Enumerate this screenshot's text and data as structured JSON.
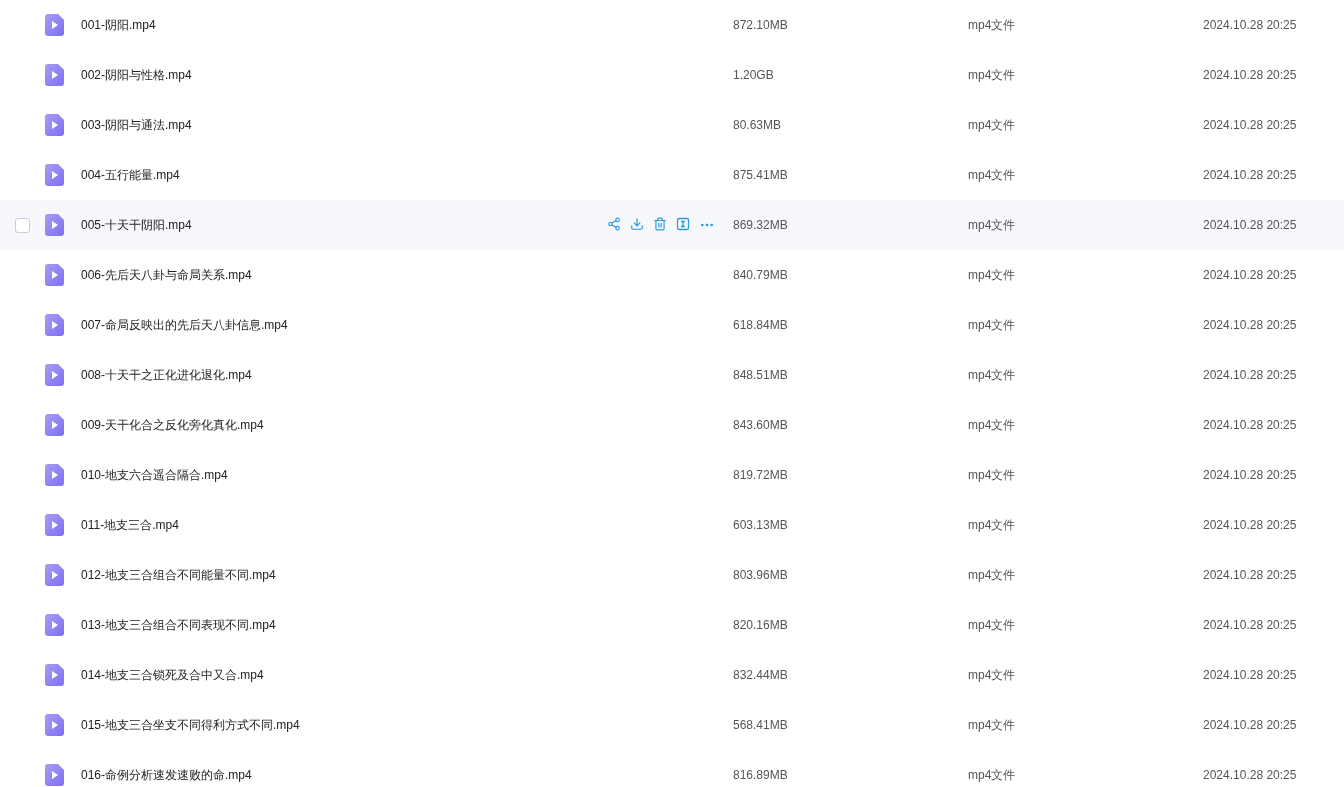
{
  "files": [
    {
      "name": "001-阴阳.mp4",
      "size": "872.10MB",
      "type": "mp4文件",
      "date": "2024.10.28 20:25",
      "hovered": false
    },
    {
      "name": "002-阴阳与性格.mp4",
      "size": "1.20GB",
      "type": "mp4文件",
      "date": "2024.10.28 20:25",
      "hovered": false
    },
    {
      "name": "003-阴阳与通法.mp4",
      "size": "80.63MB",
      "type": "mp4文件",
      "date": "2024.10.28 20:25",
      "hovered": false
    },
    {
      "name": "004-五行能量.mp4",
      "size": "875.41MB",
      "type": "mp4文件",
      "date": "2024.10.28 20:25",
      "hovered": false
    },
    {
      "name": "005-十天干阴阳.mp4",
      "size": "869.32MB",
      "type": "mp4文件",
      "date": "2024.10.28 20:25",
      "hovered": true
    },
    {
      "name": "006-先后天八卦与命局关系.mp4",
      "size": "840.79MB",
      "type": "mp4文件",
      "date": "2024.10.28 20:25",
      "hovered": false
    },
    {
      "name": "007-命局反映出的先后天八卦信息.mp4",
      "size": "618.84MB",
      "type": "mp4文件",
      "date": "2024.10.28 20:25",
      "hovered": false
    },
    {
      "name": "008-十天干之正化进化退化.mp4",
      "size": "848.51MB",
      "type": "mp4文件",
      "date": "2024.10.28 20:25",
      "hovered": false
    },
    {
      "name": "009-天干化合之反化旁化真化.mp4",
      "size": "843.60MB",
      "type": "mp4文件",
      "date": "2024.10.28 20:25",
      "hovered": false
    },
    {
      "name": "010-地支六合遥合隔合.mp4",
      "size": "819.72MB",
      "type": "mp4文件",
      "date": "2024.10.28 20:25",
      "hovered": false
    },
    {
      "name": "011-地支三合.mp4",
      "size": "603.13MB",
      "type": "mp4文件",
      "date": "2024.10.28 20:25",
      "hovered": false
    },
    {
      "name": "012-地支三合组合不同能量不同.mp4",
      "size": "803.96MB",
      "type": "mp4文件",
      "date": "2024.10.28 20:25",
      "hovered": false
    },
    {
      "name": "013-地支三合组合不同表现不同.mp4",
      "size": "820.16MB",
      "type": "mp4文件",
      "date": "2024.10.28 20:25",
      "hovered": false
    },
    {
      "name": "014-地支三合锁死及合中又合.mp4",
      "size": "832.44MB",
      "type": "mp4文件",
      "date": "2024.10.28 20:25",
      "hovered": false
    },
    {
      "name": "015-地支三合坐支不同得利方式不同.mp4",
      "size": "568.41MB",
      "type": "mp4文件",
      "date": "2024.10.28 20:25",
      "hovered": false
    },
    {
      "name": "016-命例分析速发速败的命.mp4",
      "size": "816.89MB",
      "type": "mp4文件",
      "date": "2024.10.28 20:25",
      "hovered": false
    }
  ]
}
